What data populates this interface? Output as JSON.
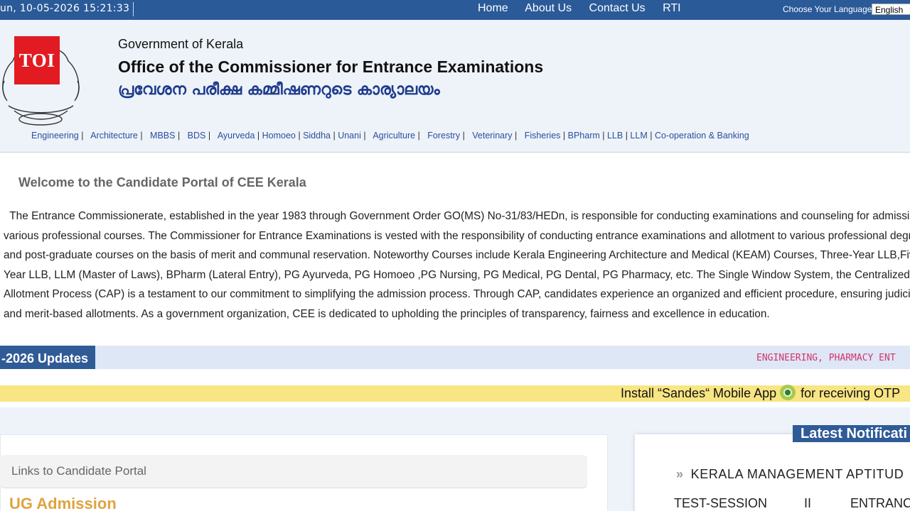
{
  "topbar": {
    "datetime": "un, 10-05-2026 15:21:33",
    "nav": [
      "Home",
      "About Us",
      "Contact Us",
      "RTI"
    ],
    "language_label": "Choose Your Language",
    "language_value": "English"
  },
  "header": {
    "logo_text": "TOI",
    "government": "Government of Kerala",
    "office": "Office of the Commissioner for Entrance Examinations",
    "office_malayalam": "പ്രവേശന പരീക്ഷ കമ്മീഷണറുടെ കാര്യാലയം"
  },
  "courses": [
    "Engineering",
    "Architecture",
    "MBBS",
    "BDS",
    "Ayurveda",
    "Homoeo",
    "Siddha",
    "Unani",
    "Agriculture",
    "Forestry",
    "Veterinary",
    "Fisheries",
    "BPharm",
    "LLB",
    "LLM",
    "Co-operation & Banking"
  ],
  "welcome": {
    "title": "Welcome to the Candidate Portal of CEE Kerala",
    "lines": [
      "  The Entrance Commissionerate, established in the year 1983 through Government Order GO(MS) No-31/83/HEDn, is responsible for conducting examinations and counseling for admission to",
      "various professional courses. The Commissioner for Entrance Examinations is vested with the responsibility of conducting entrance examinations and allotment to various professional degree",
      "and post-graduate courses on the basis of merit and communal reservation. Noteworthy Courses include Kerala Engineering Architecture and Medical (KEAM) Courses, Three-Year LLB,Five-",
      "Year LLB, LLM (Master of Laws), BPharm (Lateral Entry), PG Ayurveda, PG Homoeo ,PG Nursing, PG Medical, PG Dental, PG Pharmacy, etc. The Single Window System, the Centralized",
      "Allotment Process (CAP) is a testament to our commitment to simplifying the admission process. Through CAP, candidates experience an organized and efficient procedure, ensuring judicious",
      "and merit-based allotments. As a government organization, CEE is dedicated to upholding the principles of transparency, fairness and excellence in education."
    ]
  },
  "updates": {
    "label": "-2026 Updates",
    "ticker": "ENGINEERING, PHARMACY ENT"
  },
  "sandes": {
    "before": "Install “Sandes“ Mobile App",
    "after": "for receiving OTP"
  },
  "portal": {
    "links_title": "Links to Candidate Portal",
    "section": "UG Admission"
  },
  "notifications": {
    "label": "Latest Notificati",
    "line1": "KERALA MANAGEMENT APTITUD",
    "line2": [
      "TEST-SESSION",
      "II",
      "ENTRANC"
    ]
  },
  "colors": {
    "topbar": "#2a5a98",
    "header_bg": "#eef3fa",
    "link": "#2a4f9c",
    "ticker": "#d6336c",
    "yellow": "#f8e583",
    "accent_orange": "#e0a33f"
  }
}
